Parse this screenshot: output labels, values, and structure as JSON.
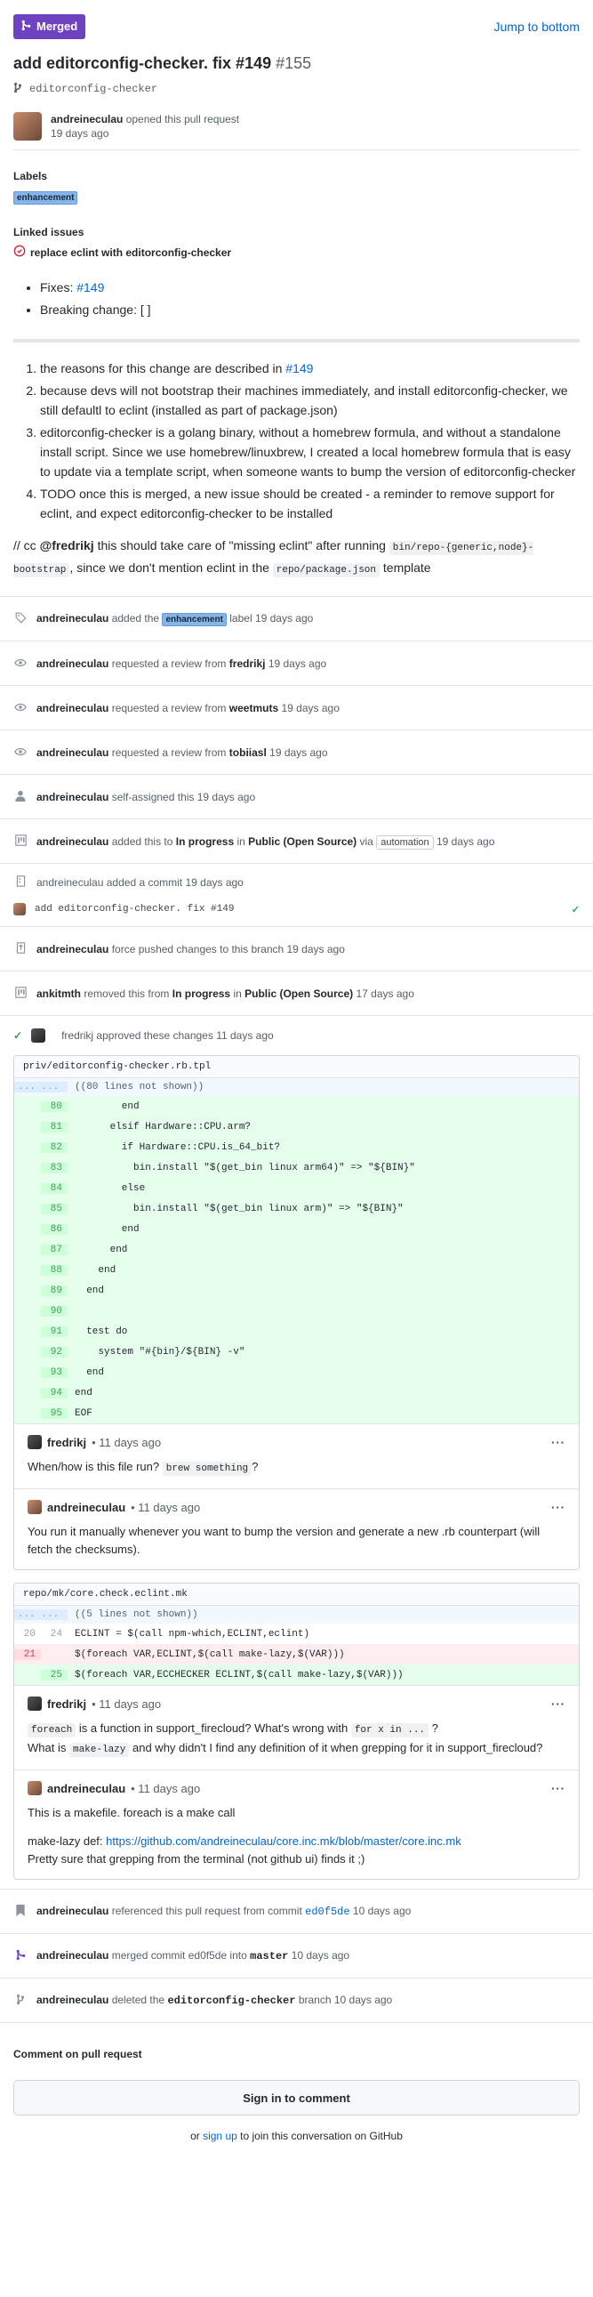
{
  "header": {
    "state_badge": "Merged",
    "jump_link": "Jump to bottom"
  },
  "pr": {
    "title": "add editorconfig-checker. fix #149",
    "number": "#155",
    "branch": "editorconfig-checker",
    "author": "andreineculau",
    "opened_text": "opened this pull request",
    "opened_time": "19 days ago"
  },
  "labels": {
    "heading": "Labels",
    "items": [
      "enhancement"
    ]
  },
  "linked_issues": {
    "heading": "Linked issues",
    "items": [
      "replace eclint with editorconfig-checker"
    ]
  },
  "body": {
    "bullets": [
      {
        "text": "Fixes: ",
        "link": "#149"
      },
      {
        "text": "Breaking change: [ ]"
      }
    ],
    "ordered": [
      {
        "text": "the reasons for this change are described in ",
        "link": "#149"
      },
      {
        "text": "because devs will not bootstrap their machines immediately, and install editorconfig-checker, we still defaultl to eclint (installed as part of package.json)"
      },
      {
        "text": "editorconfig-checker is a golang binary, without a homebrew formula, and without a standalone install script. Since we use homebrew/linuxbrew, I created a local homebrew formula that is easy to update via a template script, when someone wants to bump the version of editorconfig-checker"
      },
      {
        "text": "TODO once this is merged, a new issue should be created - a reminder to remove support for eclint, and expect editorconfig-checker to be installed"
      }
    ],
    "cc": {
      "prefix": "// cc ",
      "mention": "@fredrikj",
      "part1": " this should take care of \"missing eclint\" after running ",
      "code1": "bin/repo-{generic,node}-bootstrap",
      "part2": ", since we don't mention eclint in the ",
      "code2": "repo/package.json",
      "part3": " template"
    }
  },
  "timeline": {
    "label_event": {
      "actor": "andreineculau",
      "before": "added the",
      "label": "enhancement",
      "after": "label 19 days ago"
    },
    "review_requests": [
      {
        "actor": "andreineculau",
        "text": "requested a review from",
        "target": "fredrikj",
        "time": "19 days ago"
      },
      {
        "actor": "andreineculau",
        "text": "requested a review from",
        "target": "weetmuts",
        "time": "19 days ago"
      },
      {
        "actor": "andreineculau",
        "text": "requested a review from",
        "target": "tobiiasl",
        "time": "19 days ago"
      }
    ],
    "self_assign": {
      "actor": "andreineculau",
      "text": "self-assigned this 19 days ago"
    },
    "project_add": {
      "actor": "andreineculau",
      "text1": "added this to",
      "column": "In progress",
      "in": "in",
      "project": "Public (Open Source)",
      "via": "via",
      "bot": "automation",
      "time": "19 days ago"
    },
    "commit": {
      "actor": "andreineculau",
      "text": "added a commit 19 days ago",
      "message": "add editorconfig-checker. fix #149"
    },
    "force_push": {
      "actor": "andreineculau",
      "text": "force pushed changes to this branch 19 days ago"
    },
    "project_remove": {
      "actor": "ankitmth",
      "text1": "removed this from",
      "column": "In progress",
      "in": "in",
      "project": "Public (Open Source)",
      "time": "17 days ago"
    },
    "approval": {
      "actor": "fredrikj",
      "text": "approved these changes 11 days ago"
    }
  },
  "review": {
    "file1": {
      "path": "priv/editorconfig-checker.rb.tpl",
      "hunk_dots": "... ...",
      "hunk_text": "((80 lines not shown))",
      "lines": [
        {
          "n": "80",
          "code": "        end"
        },
        {
          "n": "81",
          "code": "      elsif Hardware::CPU.arm?"
        },
        {
          "n": "82",
          "code": "        if Hardware::CPU.is_64_bit?"
        },
        {
          "n": "83",
          "code": "          bin.install \"$(get_bin linux arm64)\" => \"${BIN}\""
        },
        {
          "n": "84",
          "code": "        else"
        },
        {
          "n": "85",
          "code": "          bin.install \"$(get_bin linux arm)\" => \"${BIN}\""
        },
        {
          "n": "86",
          "code": "        end"
        },
        {
          "n": "87",
          "code": "      end"
        },
        {
          "n": "88",
          "code": "    end"
        },
        {
          "n": "89",
          "code": "  end"
        },
        {
          "n": "90",
          "code": ""
        },
        {
          "n": "91",
          "code": "  test do"
        },
        {
          "n": "92",
          "code": "    system \"#{bin}/${BIN} -v\""
        },
        {
          "n": "93",
          "code": "  end"
        },
        {
          "n": "94",
          "code": "end"
        },
        {
          "n": "95",
          "code": "EOF"
        }
      ],
      "comments": [
        {
          "author": "fredrikj",
          "time": "• 11 days ago",
          "before": "When/how is this file run? ",
          "code": "brew something",
          "after": "?"
        },
        {
          "author": "andreineculau",
          "time": "• 11 days ago",
          "text": "You run it manually whenever you want to bump the version and generate a new .rb counterpart (will fetch the checksums)."
        }
      ]
    },
    "file2": {
      "path": "repo/mk/core.check.eclint.mk",
      "hunk_dots": "... ...",
      "hunk_text": "((5 lines not shown))",
      "ctx": {
        "n1": "20",
        "n2": "24",
        "code": "ECLINT = $(call npm-which,ECLINT,eclint)"
      },
      "del": {
        "n1": "21",
        "code": "$(foreach VAR,ECLINT,$(call make-lazy,$(VAR)))"
      },
      "add": {
        "n2": "25",
        "code": "$(foreach VAR,ECCHECKER ECLINT,$(call make-lazy,$(VAR)))"
      },
      "comments": [
        {
          "author": "fredrikj",
          "time": "• 11 days ago",
          "c1": "foreach",
          "t1": " is a function in support_firecloud? What's wrong with ",
          "c2": "for x in ...",
          "t2": " ?",
          "t3": "What is ",
          "c3": "make-lazy",
          "t4": " and why didn't I find any definition of it when grepping for it in support_firecloud?"
        },
        {
          "author": "andreineculau",
          "time": "• 11 days ago",
          "line1": "This is a makefile. foreach is a make call",
          "line2_prefix": "make-lazy def: ",
          "line2_link": "https://github.com/andreineculau/core.inc.mk/blob/master/core.inc.mk",
          "line3": "Pretty sure that grepping from the terminal (not github ui) finds it ;)"
        }
      ]
    }
  },
  "tail_events": {
    "referenced": {
      "actor": "andreineculau",
      "text": "referenced this pull request from commit",
      "sha": "ed0f5de",
      "time": "10 days ago"
    },
    "merged": {
      "actor": "andreineculau",
      "text1": "merged commit ed0f5de into",
      "branch": "master",
      "time": "10 days ago"
    },
    "deleted": {
      "actor": "andreineculau",
      "text1": "deleted the",
      "branch": "editorconfig-checker",
      "text2": "branch 10 days ago"
    }
  },
  "footer": {
    "comment_heading": "Comment on pull request",
    "signin_button": "Sign in to comment",
    "or": "or ",
    "signup": "sign up",
    "join": " to join this conversation on GitHub"
  },
  "colors": {
    "merged": "#6f42c1",
    "link": "#0366d6",
    "add_bg": "#e6ffed",
    "del_bg": "#ffeef0"
  }
}
